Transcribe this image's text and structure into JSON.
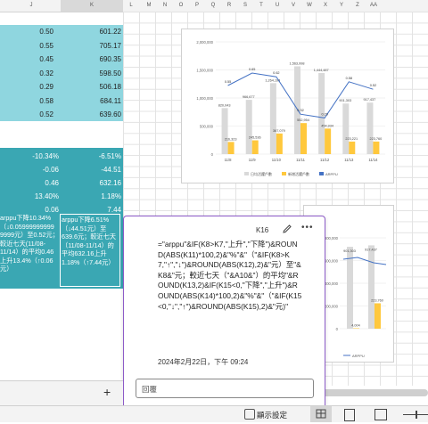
{
  "columns": {
    "j": "J",
    "k": "K",
    "l": "L",
    "m": "M",
    "n": "N",
    "o": "O",
    "p": "P",
    "q": "Q",
    "r": "R",
    "s": "S",
    "t": "T",
    "u": "U",
    "v": "V",
    "w": "W",
    "x": "X",
    "y": "Y",
    "z": "Z",
    "aa": "AA"
  },
  "table_top": {
    "rows": [
      {
        "j": "0.50",
        "k": "601.22"
      },
      {
        "j": "0.55",
        "k": "705.17"
      },
      {
        "j": "0.45",
        "k": "690.35"
      },
      {
        "j": "0.32",
        "k": "598.50"
      },
      {
        "j": "0.29",
        "k": "506.18"
      },
      {
        "j": "0.58",
        "k": "684.11"
      },
      {
        "j": "0.52",
        "k": "639.60"
      }
    ]
  },
  "table_bottom": {
    "rows": [
      {
        "j": "-10.34%",
        "k": "-6.51%"
      },
      {
        "j": "-0.06",
        "k": "-44.51"
      },
      {
        "j": "0.46",
        "k": "632.16"
      },
      {
        "j": "13.40%",
        "k": "1.18%"
      },
      {
        "j": "0.06",
        "k": "7.44"
      }
    ],
    "text_j": "arppu下降10.34%（↓0.05999999999 9999元）至0.52元；較近七天(11/08-11/14）的平均0.46上升13.4%（↑0.06元）",
    "text_k": "arppu下降6.51%（↓44.51元）至639.6元；較近七天（11/08-11/14）的平均632.16上升1.18%（↑7.44元）"
  },
  "chart1": {
    "y_ticks": [
      "2,000,000",
      "1,500,000",
      "1,000,000",
      "500,000",
      "0"
    ],
    "x_labels": [
      "11/8",
      "11/9",
      "11/10",
      "11/11",
      "11/12",
      "11/13",
      "11/14"
    ],
    "bar_labels": [
      "820,043",
      "966,677",
      "1,264,198",
      "1,563,998",
      "1,444,487",
      "901,303",
      "917,437"
    ],
    "yellow_labels": [
      "216,323",
      "245,536",
      "367,079",
      "552,954",
      "454,934",
      "223,221",
      "223,760"
    ],
    "line_labels": [
      "0.55",
      "0.65",
      "0.62",
      "0.32",
      "0.29",
      "0.58",
      "0.52"
    ],
    "legend": [
      "日均活躍戶數",
      "新增活躍戶數",
      "ARPPU"
    ]
  },
  "chart2": {
    "y_ticks": [
      "800,000",
      "600,000",
      "400,000",
      "200,000",
      "0"
    ],
    "bar_labels": [
      "901,303",
      "917,437"
    ],
    "yellow_labels": [
      "4,004",
      "223,760"
    ],
    "legend_text": "ARPPU"
  },
  "comment": {
    "cell": "K16",
    "formula": "=\"arppu\"&IF(K8>K7,\"上升\",\"下降\")&ROUND(ABS(K11)*100,2)&\"%\"&\"（\"&IF(K8>K7,\"↑\",\"↓\")&ROUND(ABS(K12),2)&\"元）至\"&K8&\"元；較近七天（\"&A10&\"）的平均\"&ROUND(K13,2)&IF(K15<0,\"下降\",\"上升\")&ROUND(ABS(K14)*100,2)&\"%\"&\"（\"&IF(K15<0,\"↓\",\"↑\")&ROUND(ABS(K15),2)&\"元)\"",
    "timestamp": "2024年2月22日，下午 09:24",
    "reply_placeholder": "回覆"
  },
  "statusbar": {
    "display_settings": "顯示設定",
    "add_sheet": "+"
  },
  "colors": {
    "teal_light": "#8fd6df",
    "teal_dark": "#3aa7b3",
    "teal_darker": "#2e8f99",
    "accent": "#7b4fc2",
    "bar_gray": "#d9d9d9",
    "bar_yellow": "#ffc83d",
    "line_blue": "#4472c4"
  }
}
